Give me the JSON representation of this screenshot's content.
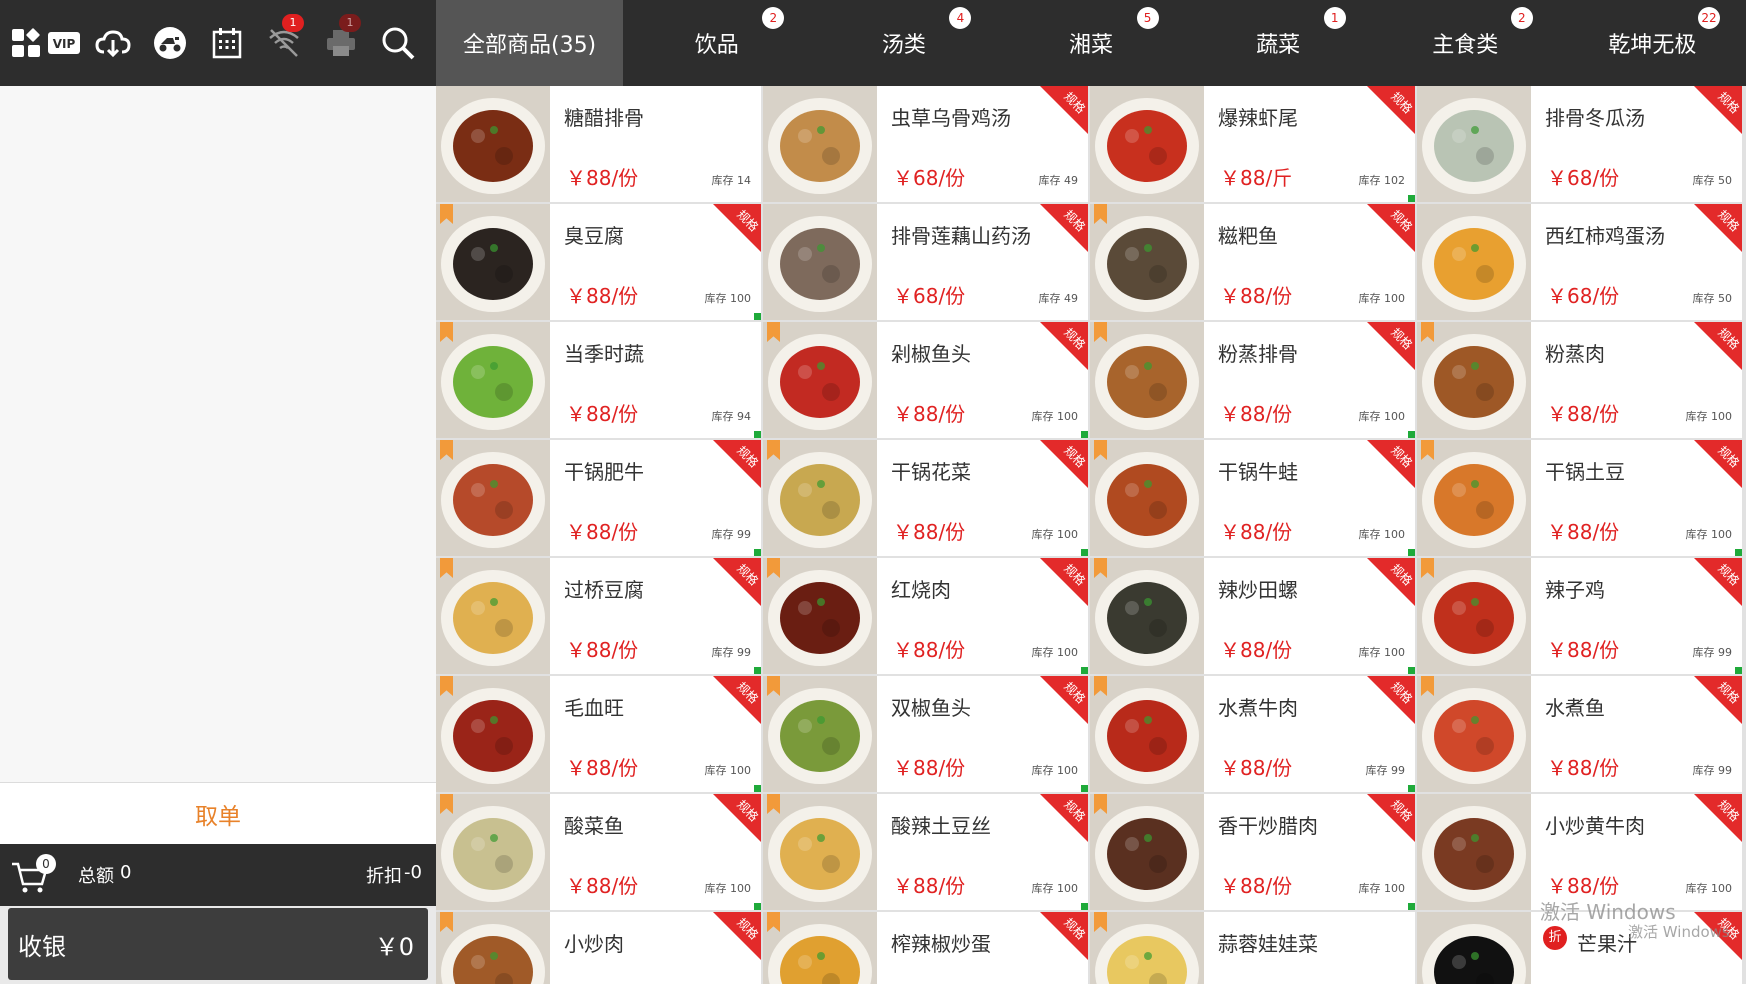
{
  "toolbar": {
    "icons": [
      {
        "name": "apps-icon",
        "badge": ""
      },
      {
        "name": "vip-icon",
        "badge": ""
      },
      {
        "name": "cloud-download-icon",
        "badge": ""
      },
      {
        "name": "delivery-scooter-icon",
        "badge": ""
      },
      {
        "name": "calendar-icon",
        "badge": ""
      },
      {
        "name": "wifi-off-icon",
        "badge": "1"
      },
      {
        "name": "printer-icon",
        "badge": "1"
      },
      {
        "name": "search-icon",
        "badge": ""
      }
    ]
  },
  "tabs": [
    {
      "label": "全部商品(35)",
      "badge": "",
      "active": true
    },
    {
      "label": "饮品",
      "badge": "2"
    },
    {
      "label": "汤类",
      "badge": "4"
    },
    {
      "label": "湘菜",
      "badge": "5"
    },
    {
      "label": "蔬菜",
      "badge": "1"
    },
    {
      "label": "主食类",
      "badge": "2"
    },
    {
      "label": "乾坤无极",
      "badge": "22"
    }
  ],
  "order": {
    "take_order_label": "取单",
    "cart_count": "0",
    "total_label": "总额",
    "total_value": "0",
    "discount_label": "折扣",
    "discount_value": "-0",
    "checkout_label": "收银",
    "checkout_amount": "￥0"
  },
  "products": [
    {
      "name": "糖醋排骨",
      "price": "￥88/份",
      "stock": "库存 14",
      "spec": "",
      "bookmark": false,
      "green": false,
      "img": "#7a2d14"
    },
    {
      "name": "虫草乌骨鸡汤",
      "price": "￥68/份",
      "stock": "库存 49",
      "spec": "规格",
      "bookmark": false,
      "green": false,
      "img": "#c28c4a"
    },
    {
      "name": "爆辣虾尾",
      "price": "￥88/斤",
      "stock": "库存 102",
      "spec": "规格",
      "bookmark": false,
      "green": true,
      "img": "#c8301e"
    },
    {
      "name": "排骨冬瓜汤",
      "price": "￥68/份",
      "stock": "库存 50",
      "spec": "规格",
      "bookmark": false,
      "green": false,
      "img": "#b9c4b4"
    },
    {
      "name": "臭豆腐",
      "price": "￥88/份",
      "stock": "库存 100",
      "spec": "规格",
      "bookmark": true,
      "green": true,
      "img": "#2b2420"
    },
    {
      "name": "排骨莲藕山药汤",
      "price": "￥68/份",
      "stock": "库存 49",
      "spec": "规格",
      "bookmark": false,
      "green": false,
      "img": "#7e6a5c"
    },
    {
      "name": "糍粑鱼",
      "price": "￥88/份",
      "stock": "库存 100",
      "spec": "规格",
      "bookmark": true,
      "green": false,
      "img": "#5a4a38"
    },
    {
      "name": "西红柿鸡蛋汤",
      "price": "￥68/份",
      "stock": "库存 50",
      "spec": "规格",
      "bookmark": false,
      "green": false,
      "img": "#e8a030"
    },
    {
      "name": "当季时蔬",
      "price": "￥88/份",
      "stock": "库存 94",
      "spec": "",
      "bookmark": true,
      "green": true,
      "img": "#6fb23a"
    },
    {
      "name": "剁椒鱼头",
      "price": "￥88/份",
      "stock": "库存 100",
      "spec": "规格",
      "bookmark": true,
      "green": true,
      "img": "#c22a22"
    },
    {
      "name": "粉蒸排骨",
      "price": "￥88/份",
      "stock": "库存 100",
      "spec": "规格",
      "bookmark": true,
      "green": true,
      "img": "#a8642c"
    },
    {
      "name": "粉蒸肉",
      "price": "￥88/份",
      "stock": "库存 100",
      "spec": "规格",
      "bookmark": true,
      "green": false,
      "img": "#9e5826"
    },
    {
      "name": "干锅肥牛",
      "price": "￥88/份",
      "stock": "库存 99",
      "spec": "规格",
      "bookmark": true,
      "green": true,
      "img": "#b64a2a"
    },
    {
      "name": "干锅花菜",
      "price": "￥88/份",
      "stock": "库存 100",
      "spec": "规格",
      "bookmark": true,
      "green": true,
      "img": "#c8a850"
    },
    {
      "name": "干锅牛蛙",
      "price": "￥88/份",
      "stock": "库存 100",
      "spec": "规格",
      "bookmark": true,
      "green": true,
      "img": "#b04a20"
    },
    {
      "name": "干锅土豆",
      "price": "￥88/份",
      "stock": "库存 100",
      "spec": "规格",
      "bookmark": true,
      "green": true,
      "img": "#d8782a"
    },
    {
      "name": "过桥豆腐",
      "price": "￥88/份",
      "stock": "库存 99",
      "spec": "规格",
      "bookmark": true,
      "green": true,
      "img": "#e0b050"
    },
    {
      "name": "红烧肉",
      "price": "￥88/份",
      "stock": "库存 100",
      "spec": "规格",
      "bookmark": true,
      "green": true,
      "img": "#6a1e12"
    },
    {
      "name": "辣炒田螺",
      "price": "￥88/份",
      "stock": "库存 100",
      "spec": "规格",
      "bookmark": true,
      "green": true,
      "img": "#3a3a30"
    },
    {
      "name": "辣子鸡",
      "price": "￥88/份",
      "stock": "库存 99",
      "spec": "规格",
      "bookmark": true,
      "green": true,
      "img": "#c0301c"
    },
    {
      "name": "毛血旺",
      "price": "￥88/份",
      "stock": "库存 100",
      "spec": "规格",
      "bookmark": true,
      "green": true,
      "img": "#9a2418"
    },
    {
      "name": "双椒鱼头",
      "price": "￥88/份",
      "stock": "库存 100",
      "spec": "规格",
      "bookmark": true,
      "green": true,
      "img": "#7a9a3a"
    },
    {
      "name": "水煮牛肉",
      "price": "￥88/份",
      "stock": "库存 99",
      "spec": "规格",
      "bookmark": true,
      "green": true,
      "img": "#b82a1a"
    },
    {
      "name": "水煮鱼",
      "price": "￥88/份",
      "stock": "库存 99",
      "spec": "规格",
      "bookmark": true,
      "green": false,
      "img": "#d0482a"
    },
    {
      "name": "酸菜鱼",
      "price": "￥88/份",
      "stock": "库存 100",
      "spec": "规格",
      "bookmark": true,
      "green": true,
      "img": "#c8c090"
    },
    {
      "name": "酸辣土豆丝",
      "price": "￥88/份",
      "stock": "库存 100",
      "spec": "规格",
      "bookmark": true,
      "green": true,
      "img": "#e0b050"
    },
    {
      "name": "香干炒腊肉",
      "price": "￥88/份",
      "stock": "库存 100",
      "spec": "规格",
      "bookmark": true,
      "green": true,
      "img": "#5a3020"
    },
    {
      "name": "小炒黄牛肉",
      "price": "￥88/份",
      "stock": "库存 100",
      "spec": "规格",
      "bookmark": false,
      "green": false,
      "img": "#7a3a22"
    },
    {
      "name": "小炒肉",
      "price": "",
      "stock": "",
      "spec": "规格",
      "bookmark": true,
      "green": false,
      "img": "#a05a28"
    },
    {
      "name": "榨辣椒炒蛋",
      "price": "",
      "stock": "",
      "spec": "规格",
      "bookmark": true,
      "green": false,
      "img": "#e0a030"
    },
    {
      "name": "蒜蓉娃娃菜",
      "price": "",
      "stock": "",
      "spec": "",
      "bookmark": true,
      "green": false,
      "img": "#e8c860"
    },
    {
      "name": "芒果汁",
      "price": "",
      "stock": "",
      "spec": "规格",
      "bookmark": false,
      "green": false,
      "img": "#111111",
      "discount": "折"
    }
  ],
  "watermark": {
    "line1": "激活 Windows",
    "line2": "激活 Windows"
  },
  "colors": {
    "bar": "#2d2d2d",
    "active_tab": "#555555",
    "price": "#e02222",
    "accent": "#e8822a",
    "spec_tag": "#e32a2a",
    "stock_dot": "#1faa3a"
  }
}
